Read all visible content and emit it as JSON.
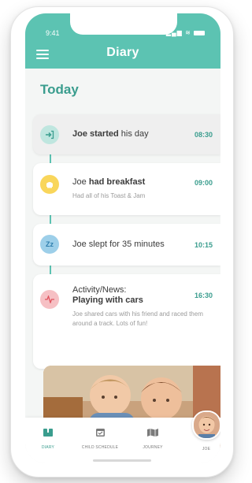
{
  "status_bar": {
    "time": "9:41"
  },
  "header": {
    "title": "Diary"
  },
  "section": {
    "title": "Today"
  },
  "entries": [
    {
      "title_name": "Joe",
      "title_rest": "started",
      "title_suffix": " his day",
      "time": "08:30",
      "icon": "login-icon",
      "color": "#8fd3c6"
    },
    {
      "title_name": "Joe",
      "title_rest": "had breakfast",
      "time": "09:00",
      "description": "Had all of his Toast & Jam",
      "icon": "food-icon",
      "color": "#f6d35a"
    },
    {
      "title_name": "Joe",
      "title_rest": " slept for 35 minutes",
      "time": "10:15",
      "icon": "sleep-icon",
      "color": "#8cc7e8"
    },
    {
      "title_line1": "Activity/News:",
      "title_line2": "Playing with cars",
      "time": "16:30",
      "description": "Joe shared cars with his friend and raced them around a track. Lots of fun!",
      "icon": "activity-icon",
      "color": "#f4a9ae"
    }
  ],
  "nav": {
    "items": [
      {
        "label": "DIARY",
        "icon": "diary-icon",
        "active": true
      },
      {
        "label": "CHILD SCHEDULE",
        "icon": "calendar-icon",
        "active": false
      },
      {
        "label": "JOURNEY",
        "icon": "journey-icon",
        "active": false
      },
      {
        "label": "JOE",
        "icon": "avatar",
        "active": false
      }
    ]
  },
  "colors": {
    "accent": "#5cc3b2",
    "accent_dark": "#3a9d8e"
  }
}
